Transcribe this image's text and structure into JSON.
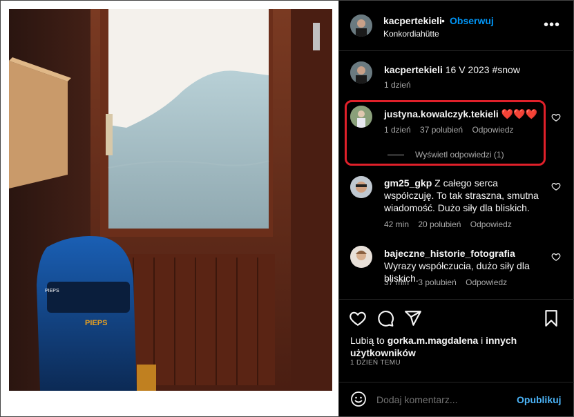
{
  "post": {
    "author": "kacpertekieli",
    "separator": "•",
    "follow_label": "Obserwuj",
    "location": "Konkordiahütte",
    "more_label": "•••"
  },
  "comments": [
    {
      "username": "kacpertekieli",
      "text": "16 V 2023 #snow",
      "time": "1 dzień",
      "likes": "",
      "reply": ""
    },
    {
      "username": "justyna.kowalczyk.tekieli",
      "text": "❤️❤️❤️",
      "time": "1 dzień",
      "likes": "37 polubień",
      "reply": "Odpowiedz",
      "view_replies": "Wyświetl odpowiedzi (1)"
    },
    {
      "username": "gm25_gkp",
      "text": "Z całego serca współczuję. To tak straszna, smutna wiadomość. Dużo siły dla bliskich.",
      "time": "42 min",
      "likes": "20 polubień",
      "reply": "Odpowiedz"
    },
    {
      "username": "bajeczne_historie_fotografia",
      "text": "Wyrazy współczucia, dużo siły dla bliskich.",
      "time": "37 min",
      "likes": "3 polubień",
      "reply": "Odpowiedz"
    }
  ],
  "likes_summary": {
    "prefix": "Lubią to ",
    "user": "gorka.m.magdalena",
    "middle": " i ",
    "others": "innych użytkowników"
  },
  "date": "1 DZIEŃ TEMU",
  "composer": {
    "placeholder": "Dodaj komentarz...",
    "post_label": "Opublikuj"
  },
  "colors": {
    "accent": "#0095f6",
    "highlight": "#e0202a",
    "heart": "#ff3040"
  }
}
